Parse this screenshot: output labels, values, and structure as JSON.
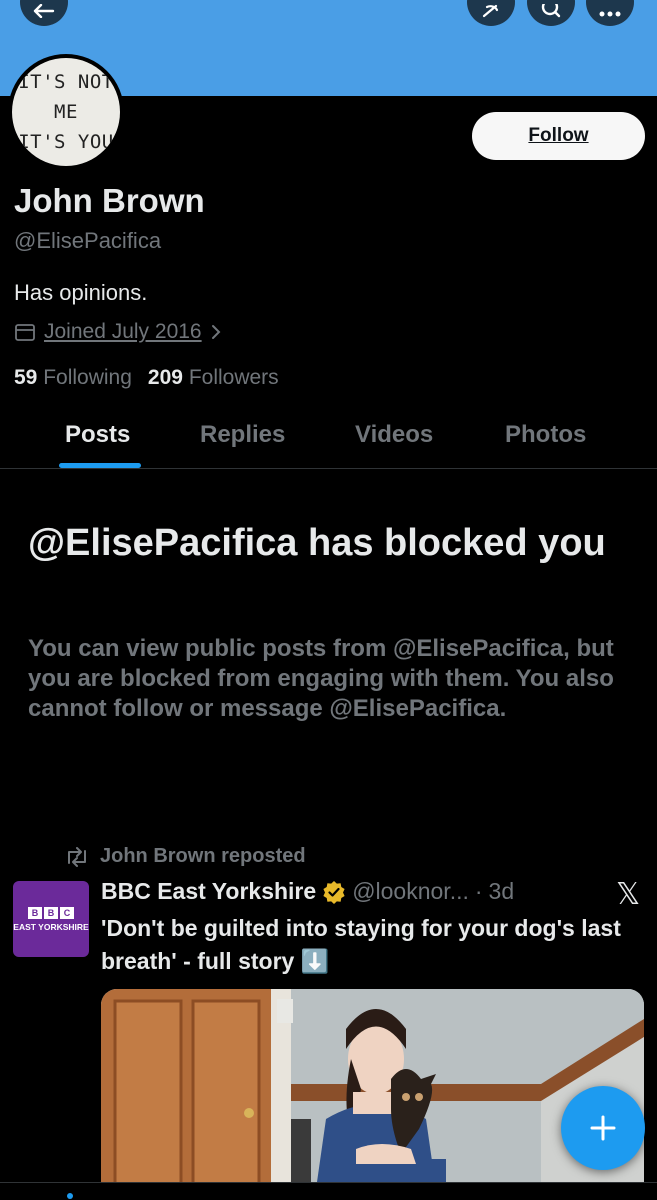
{
  "header": {
    "back_icon": "arrow-left-icon",
    "grok_icon": "grok-icon",
    "search_icon": "search-icon",
    "more_icon": "more-icon",
    "banner_color": "#4a9ee6"
  },
  "profile": {
    "avatar_lines": [
      "IT'S NOT",
      "ME",
      "IT'S YOU"
    ],
    "follow_label": "Follow",
    "name": "John Brown",
    "handle": "@ElisePacifica",
    "bio": "Has opinions.",
    "joined": "Joined July 2016",
    "following_count": "59",
    "following_label": "Following",
    "followers_count": "209",
    "followers_label": "Followers"
  },
  "tabs": [
    {
      "label": "Posts",
      "active": true
    },
    {
      "label": "Replies"
    },
    {
      "label": "Videos"
    },
    {
      "label": "Photos"
    }
  ],
  "blocked": {
    "title": "@ElisePacifica has blocked you",
    "description": "You can view public posts from @ElisePacifica, but you are blocked from engaging with them. You also cannot follow or message @ElisePacifica."
  },
  "post": {
    "repost_text": "John Brown reposted",
    "avatar_brand": [
      "B",
      "B",
      "C"
    ],
    "avatar_region": "EAST YORKSHIRE",
    "author": "BBC East Yorkshire",
    "handle": "@looknor...",
    "separator": "·",
    "time": "3d",
    "text": "'Don't be guilted into staying for your dog's last breath' - full story ⬇️",
    "x_logo": "𝕏"
  },
  "colors": {
    "accent": "#1d9bf0",
    "secondary_text": "#71767b",
    "verified_gold": "#e8b92a"
  }
}
